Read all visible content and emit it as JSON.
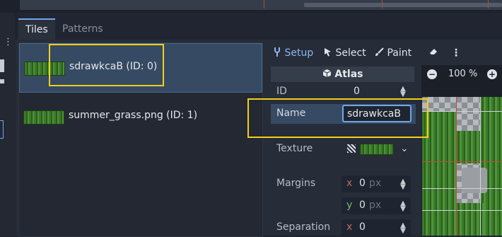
{
  "tabs": {
    "tiles": "Tiles",
    "patterns": "Patterns"
  },
  "tile_list": [
    {
      "label": "sdrawkcaB (ID: 0)",
      "selected": true
    },
    {
      "label": "summer_grass.png (ID: 1)",
      "selected": false
    }
  ],
  "toolbar": {
    "setup": "Setup",
    "select": "Select",
    "paint": "Paint"
  },
  "inspector": {
    "header": "Atlas",
    "id_label": "ID",
    "id_value": "0",
    "name_label": "Name",
    "name_value": "sdrawkcaB",
    "texture_label": "Texture",
    "margins_label": "Margins",
    "margins_x": "0",
    "margins_y": "0",
    "separation_label": "Separation",
    "separation_x": "0",
    "unit": "px",
    "x_axis": "x",
    "y_axis": "y"
  },
  "zoom": {
    "value": "100 %"
  },
  "colors": {
    "accent": "#6fa7ea",
    "highlight": "#f2cf1a",
    "selected_bg": "#364a63"
  },
  "icons": [
    "wrench-icon",
    "cursor-icon",
    "brush-icon",
    "eraser-icon",
    "kebab-menu-icon",
    "minus-icon",
    "plus-icon",
    "atlas-box-icon",
    "chevron-down-icon"
  ]
}
